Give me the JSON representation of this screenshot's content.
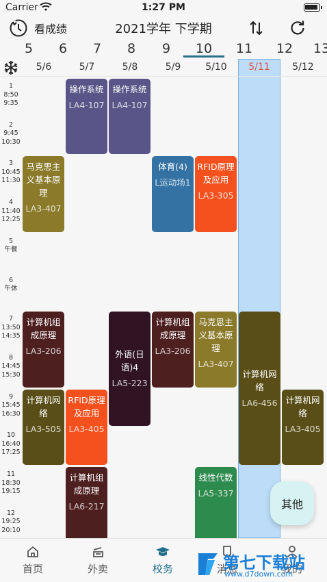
{
  "status_bar": {
    "carrier": "Carrier",
    "time": "1:27 PM"
  },
  "header": {
    "grades_label": "看成绩",
    "term_title": "2021学年  下学期"
  },
  "weeks": [
    "5",
    "6",
    "7",
    "8",
    "9",
    "10",
    "11",
    "12",
    "13"
  ],
  "active_week": "10",
  "dates": [
    "5/6",
    "5/7",
    "5/8",
    "5/9",
    "5/10",
    "5/11",
    "5/12"
  ],
  "today_date": "5/11",
  "slots": [
    {
      "label": "1",
      "start": "8:50",
      "end": "9:35"
    },
    {
      "label": "2",
      "start": "9:45",
      "end": "10:30"
    },
    {
      "label": "3",
      "start": "10:45",
      "end": "11:30"
    },
    {
      "label": "4",
      "start": "11:40",
      "end": "12:25"
    },
    {
      "label": "5",
      "start": "午餐",
      "end": ""
    },
    {
      "label": "6",
      "start": "午休",
      "end": ""
    },
    {
      "label": "7",
      "start": "13:50",
      "end": "14:35"
    },
    {
      "label": "8",
      "start": "14:45",
      "end": "15:30"
    },
    {
      "label": "9",
      "start": "15:45",
      "end": "16:30"
    },
    {
      "label": "10",
      "start": "16:40",
      "end": "17:25"
    },
    {
      "label": "11",
      "start": "18:30",
      "end": "19:15"
    },
    {
      "label": "12",
      "start": "19:25",
      "end": "20:10"
    }
  ],
  "courses": [
    {
      "day": 1,
      "start": 1,
      "span": 2,
      "name": "操作系统",
      "room": "LA4-107",
      "color": "#5a5588"
    },
    {
      "day": 2,
      "start": 1,
      "span": 2,
      "name": "操作系统",
      "room": "LA4-107",
      "color": "#5a5588"
    },
    {
      "day": 0,
      "start": 3,
      "span": 2,
      "name": "马克思主义基本原理",
      "room": "LA3-407",
      "color": "#8a7a2a"
    },
    {
      "day": 3,
      "start": 3,
      "span": 2,
      "name": "体育(4)",
      "room": "L运动场1",
      "color": "#3472a4"
    },
    {
      "day": 4,
      "start": 3,
      "span": 2,
      "name": "RFID原理及应用",
      "room": "LA3-305",
      "color": "#f4511e"
    },
    {
      "day": 0,
      "start": 7,
      "span": 2,
      "name": "计算机组成原理",
      "room": "LA3-206",
      "color": "#4e1f1f"
    },
    {
      "day": 2,
      "start": 7,
      "span": 3,
      "name": "外语(日语)4",
      "room": "LA5-223",
      "color": "#301424"
    },
    {
      "day": 3,
      "start": 7,
      "span": 2,
      "name": "计算机组成原理",
      "room": "LA3-206",
      "color": "#4e1f1f"
    },
    {
      "day": 4,
      "start": 7,
      "span": 2,
      "name": "马克思主义基本原理",
      "room": "LA3-407",
      "color": "#8a7a2a"
    },
    {
      "day": 5,
      "start": 7,
      "span": 4,
      "name": "计算机网络",
      "room": "LA6-456",
      "color": "#5a4e18"
    },
    {
      "day": 0,
      "start": 9,
      "span": 2,
      "name": "计算机网络",
      "room": "LA3-505",
      "color": "#5a4e18"
    },
    {
      "day": 1,
      "start": 9,
      "span": 2,
      "name": "RFID原理及应用",
      "room": "LA3-405",
      "color": "#f4511e"
    },
    {
      "day": 6,
      "start": 9,
      "span": 2,
      "name": "计算机网络",
      "room": "LA3-405",
      "color": "#5a4e18"
    },
    {
      "day": 1,
      "start": 11,
      "span": 2,
      "name": "计算机组成原理",
      "room": "LA6-217",
      "color": "#4e1f1f"
    },
    {
      "day": 4,
      "start": 11,
      "span": 2,
      "name": "线性代数",
      "room": "LA5-337",
      "color": "#2e8b4e"
    }
  ],
  "other_button": "其他",
  "tabs": [
    {
      "label": "首页",
      "icon": "home-icon"
    },
    {
      "label": "外卖",
      "icon": "takeout-icon"
    },
    {
      "label": "校务",
      "icon": "school-icon"
    },
    {
      "label": "消息",
      "icon": "message-icon"
    },
    {
      "label": "我的",
      "icon": "profile-icon"
    }
  ],
  "active_tab": "校务",
  "watermark": {
    "main": "第七下载站",
    "url": "www.d7down.com"
  },
  "colors": {
    "accent": "#1e6e8a",
    "today_highlight": "#bcdcf7",
    "today_text": "#e05050"
  }
}
